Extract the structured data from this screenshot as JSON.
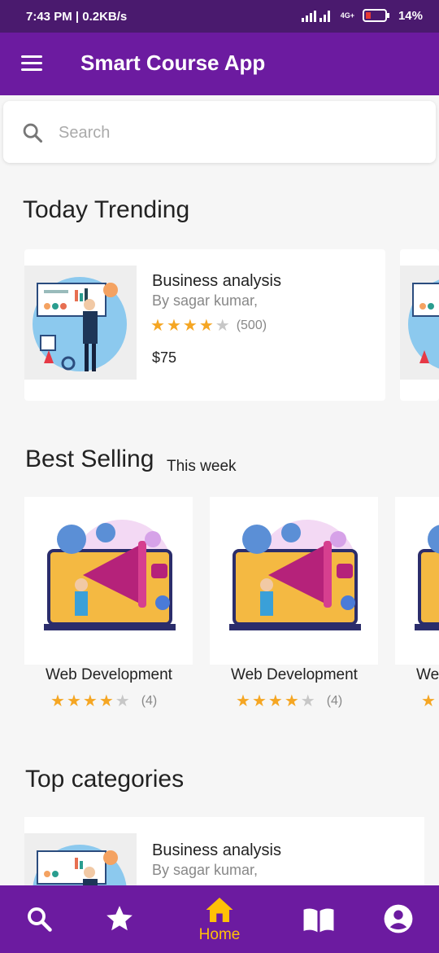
{
  "status_bar": {
    "time_text": "7:43 PM | 0.2KB/s",
    "network_label": "4G+",
    "battery": "14%"
  },
  "app_bar": {
    "title": "Smart Course App"
  },
  "search": {
    "placeholder": "Search",
    "value": ""
  },
  "sections": {
    "trending_title": "Today Trending",
    "best_selling_title": "Best Selling",
    "best_selling_subtitle": "This week",
    "categories_title": "Top categories"
  },
  "trending": [
    {
      "name": "Business analysis",
      "author": "By sagar kumar,",
      "rating": 4,
      "rating_count": "(500)",
      "price": "$75"
    }
  ],
  "best_selling": [
    {
      "name": "Web Development",
      "rating": 4,
      "rating_count": "(4)"
    },
    {
      "name": "Web Development",
      "rating": 4,
      "rating_count": "(4)"
    },
    {
      "name": "We"
    }
  ],
  "categories": [
    {
      "name": "Business analysis",
      "author": "By sagar kumar,"
    }
  ],
  "bottom_nav": {
    "active": "home",
    "home_label": "Home",
    "icons": [
      "search-icon",
      "star-icon",
      "home-icon",
      "book-icon",
      "account-icon"
    ]
  },
  "colors": {
    "primary": "#6c1ba0",
    "status_bar": "#4a1a6e",
    "star": "#f5a623",
    "nav_active": "#ffc107"
  }
}
